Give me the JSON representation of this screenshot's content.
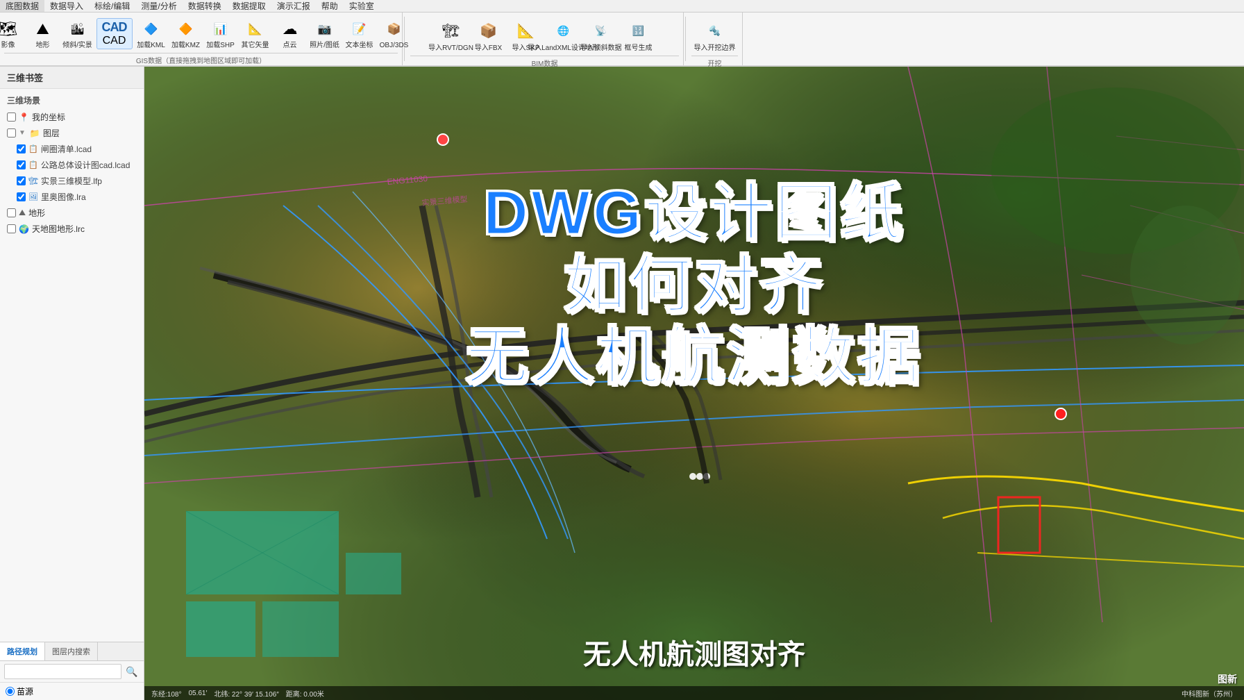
{
  "menu": {
    "items": [
      "底图数据",
      "数据导入",
      "标绘/编辑",
      "测量/分析",
      "数据转换",
      "数据提取",
      "演示汇报",
      "帮助",
      "实验室"
    ]
  },
  "toolbar": {
    "gis_section_label": "GIS数据（直接拖拽到地图区域即可加载）",
    "gis_items": [
      {
        "label": "影像",
        "icon": "🗺"
      },
      {
        "label": "地形",
        "icon": "⛰"
      },
      {
        "label": "倾斜/实景",
        "icon": "🏙"
      },
      {
        "label": "CAD",
        "icon": "CAD"
      },
      {
        "label": "加载KML",
        "icon": "🔷"
      },
      {
        "label": "加载KMZ",
        "icon": "🔶"
      },
      {
        "label": "加载SHP",
        "icon": "📊"
      },
      {
        "label": "其它矢量",
        "icon": "📐"
      },
      {
        "label": "点云",
        "icon": "☁"
      },
      {
        "label": "照片/图纸",
        "icon": "📷"
      },
      {
        "label": "文本坐标",
        "icon": "📝"
      },
      {
        "label": "OBJ/3DS",
        "icon": "📦"
      }
    ],
    "bim_section_label": "BIM数据",
    "bim_items": [
      {
        "label": "导入RVT/DGN",
        "icon": "🏗"
      },
      {
        "label": "导入FBX",
        "icon": "📦"
      },
      {
        "label": "导入SKP",
        "icon": "📐"
      },
      {
        "label": "导入LandXML设计地形",
        "icon": "🌐"
      },
      {
        "label": "导入倾斜数据",
        "icon": "📡"
      },
      {
        "label": "框号生成",
        "icon": "🔢"
      },
      {
        "label": "导入开挖边界",
        "icon": "🔩"
      }
    ],
    "kaizao_label": "开挖"
  },
  "sidebar": {
    "title": "三维书签",
    "tree_title": "三维场景",
    "tree_items": [
      {
        "label": "我的坐标",
        "icon": "📍",
        "type": "item",
        "checked": false
      },
      {
        "label": "图层",
        "icon": "📁",
        "type": "folder",
        "expanded": true,
        "children": [
          {
            "label": "闸圈清单.lcad",
            "icon": "📋",
            "color": "blue"
          },
          {
            "label": "公路总体设计图cad.lcad",
            "icon": "📋",
            "color": "blue"
          },
          {
            "label": "实景三维模型.lfp",
            "icon": "🏗",
            "color": "blue"
          },
          {
            "label": "里奥图像.lra",
            "icon": "🖼",
            "color": "blue"
          }
        ]
      },
      {
        "label": "地形",
        "icon": "⛰",
        "type": "item",
        "checked": false
      },
      {
        "label": "天地图地形.lrc",
        "icon": "🌍",
        "type": "item",
        "checked": false
      }
    ],
    "tabs": [
      "路径规划",
      "图层内搜索"
    ],
    "active_tab": "路径规划",
    "search_placeholder": "",
    "radio_options": [
      "苗源"
    ]
  },
  "main": {
    "title_line1": "DWG设计图纸",
    "title_line2": "如何对齐",
    "title_line3": "无人机航测数据",
    "subtitle": "无人机航测图对齐"
  },
  "status_bar": {
    "lat": "东经:108°",
    "lon": "05.61′",
    "coords": "北纬: 22° 39′ 15.106″",
    "distance": "距离: 0.00米",
    "corner_label": "图新"
  }
}
